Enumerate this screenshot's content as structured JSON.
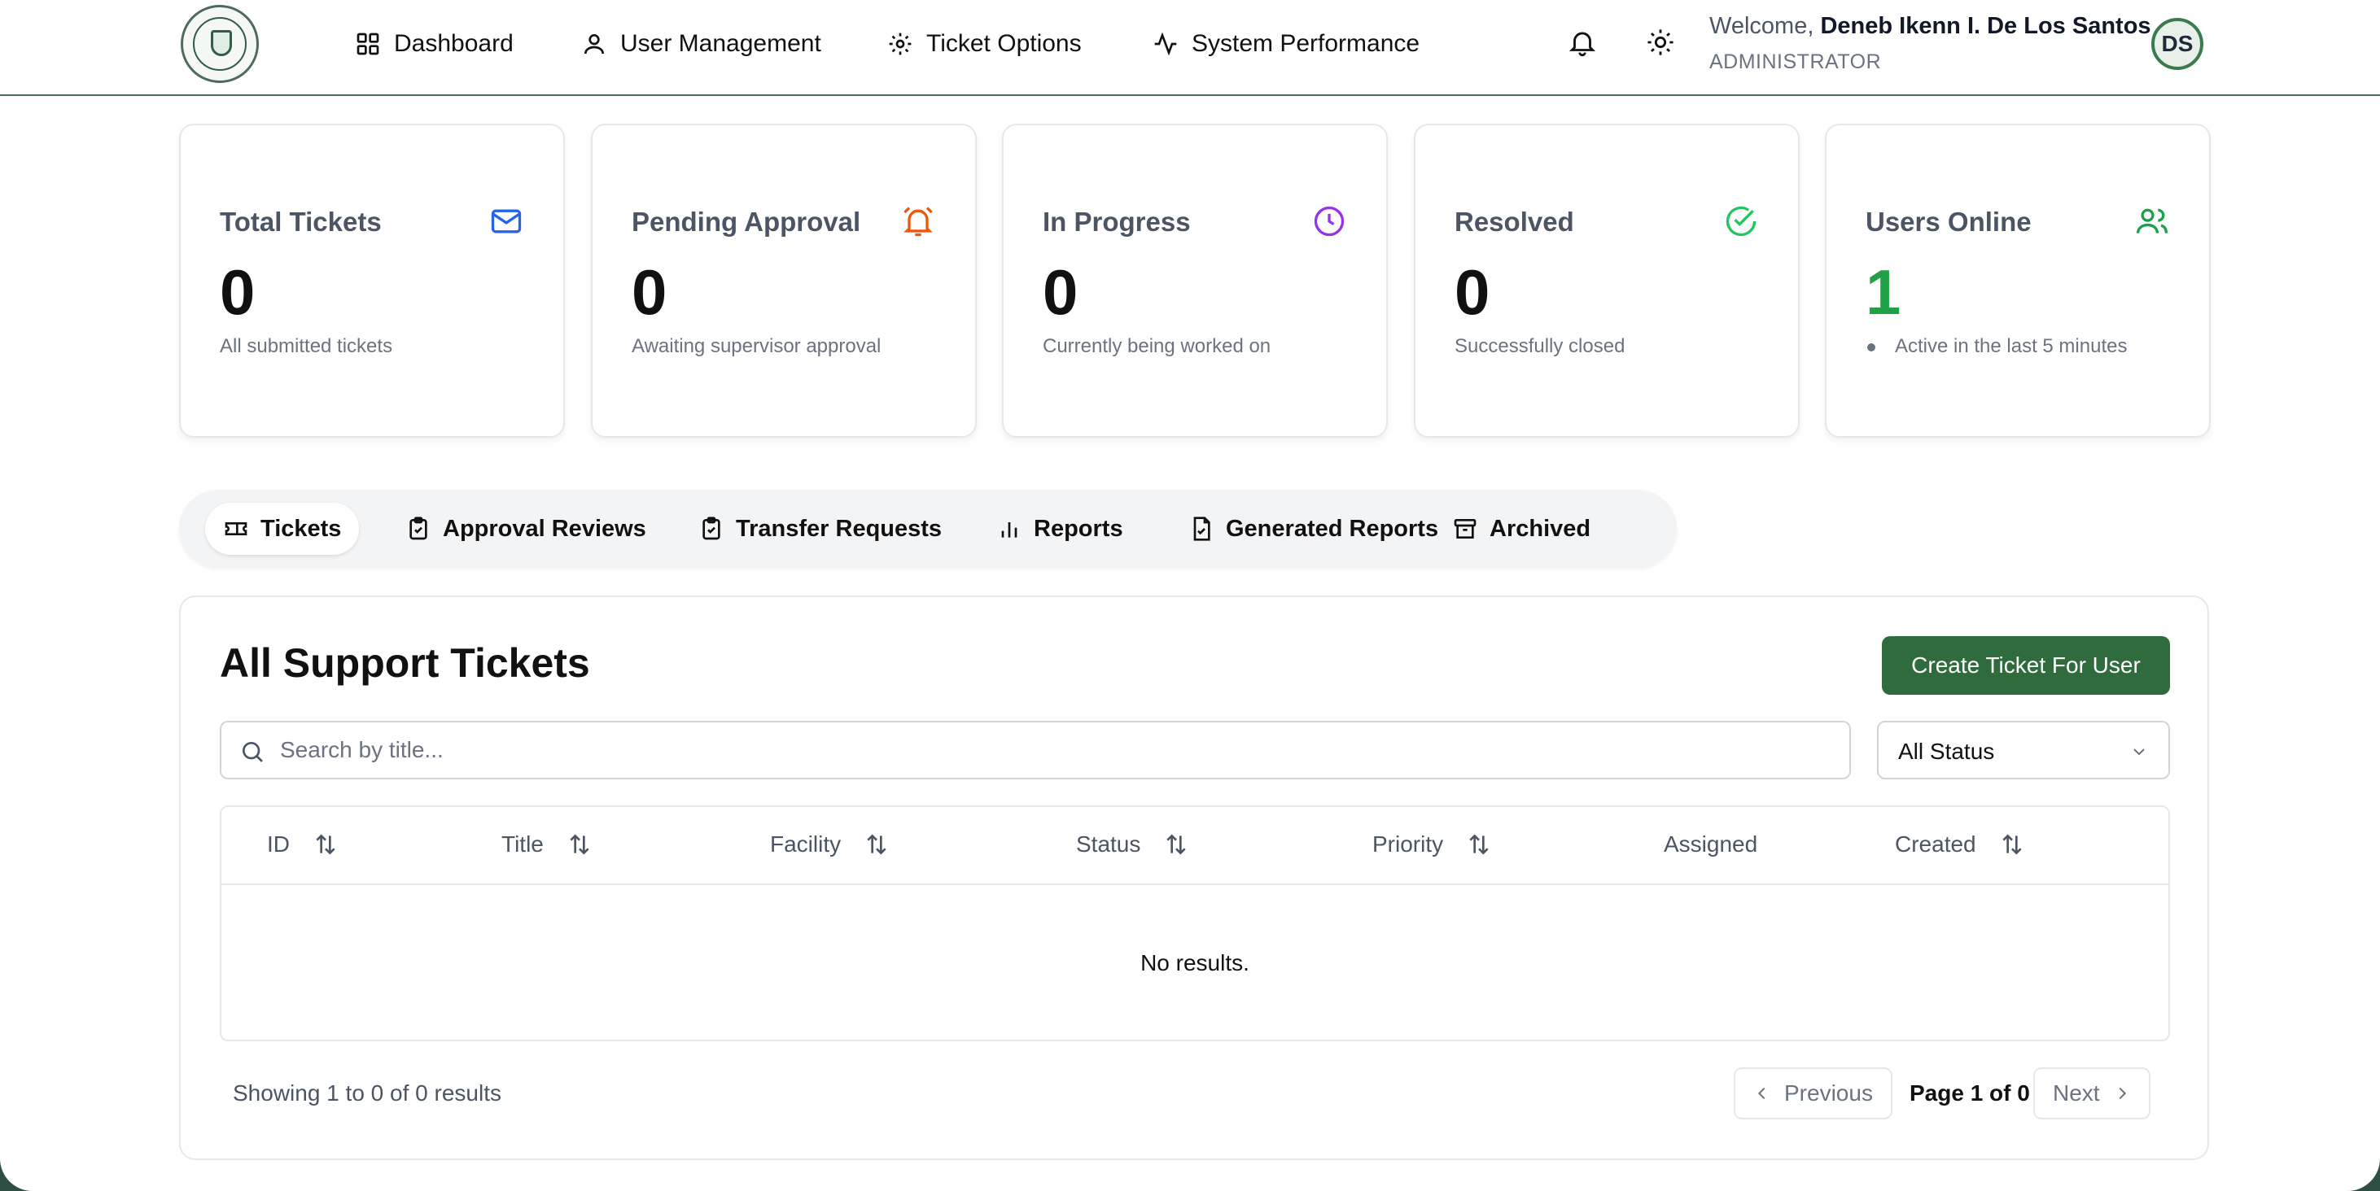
{
  "header": {
    "nav": [
      {
        "label": "Dashboard",
        "icon": "dashboard-grid-icon"
      },
      {
        "label": "User Management",
        "icon": "user-icon"
      },
      {
        "label": "Ticket Options",
        "icon": "gear-icon"
      },
      {
        "label": "System Performance",
        "icon": "activity-icon"
      }
    ],
    "welcome_prefix": "Welcome,",
    "user_name": "Deneb Ikenn I. De Los Santos",
    "role": "ADMINISTRATOR",
    "avatar_initials": "DS"
  },
  "stats": [
    {
      "label": "Total Tickets",
      "value": "0",
      "desc": "All submitted tickets",
      "icon": "mail-icon",
      "color": "#2563eb"
    },
    {
      "label": "Pending Approval",
      "value": "0",
      "desc": "Awaiting supervisor approval",
      "icon": "alarm-icon",
      "color": "#ea580c"
    },
    {
      "label": "In Progress",
      "value": "0",
      "desc": "Currently being worked on",
      "icon": "clock-icon",
      "color": "#9333ea"
    },
    {
      "label": "Resolved",
      "value": "0",
      "desc": "Successfully closed",
      "icon": "check-circle-icon",
      "color": "#22c55e"
    },
    {
      "label": "Users Online",
      "value": "1",
      "desc": "Active in the last 5 minutes",
      "icon": "users-icon",
      "color": "#16a34a"
    }
  ],
  "tabs": [
    {
      "label": "Tickets",
      "icon": "ticket-icon",
      "active": true
    },
    {
      "label": "Approval Reviews",
      "icon": "clipboard-check-icon"
    },
    {
      "label": "Transfer Requests",
      "icon": "clipboard-check-icon"
    },
    {
      "label": "Reports",
      "icon": "bar-chart-icon"
    },
    {
      "label": "Generated Reports",
      "icon": "file-check-icon"
    },
    {
      "label": "Archived",
      "icon": "archive-icon"
    }
  ],
  "main": {
    "title": "All Support Tickets",
    "create_label": "Create Ticket For User",
    "search_placeholder": "Search by title...",
    "status_filter": "All Status",
    "columns": [
      "ID",
      "Title",
      "Facility",
      "Status",
      "Priority",
      "Assigned",
      "Created"
    ],
    "empty_text": "No results.",
    "showing": "Showing 1 to 0 of 0 results",
    "prev_label": "Previous",
    "page_text": "Page 1 of 0",
    "next_label": "Next"
  },
  "colors": {
    "brand": "#2f6b3d",
    "online_value": "#22a048"
  }
}
